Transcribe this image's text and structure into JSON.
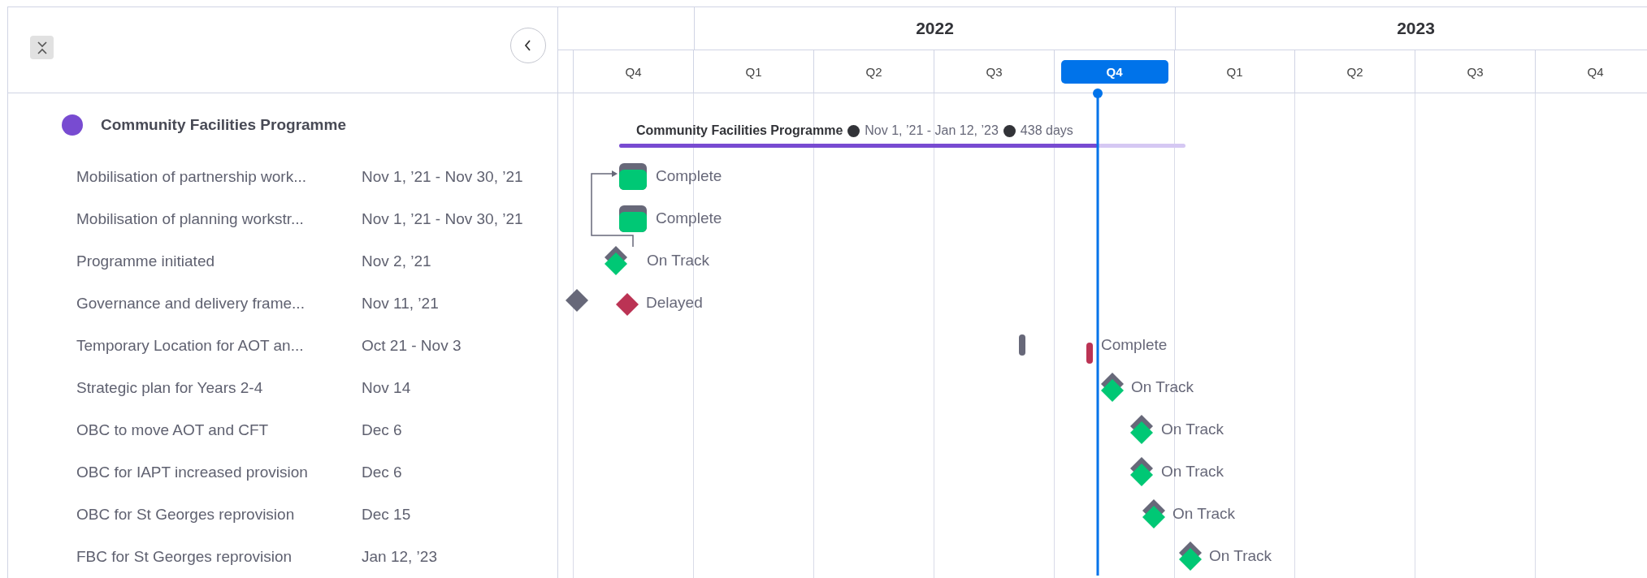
{
  "timeline": {
    "years": [
      {
        "label": "2022"
      },
      {
        "label": "2023"
      }
    ],
    "quarters": [
      {
        "label": "Q4",
        "selected": false
      },
      {
        "label": "Q1",
        "selected": false
      },
      {
        "label": "Q2",
        "selected": false
      },
      {
        "label": "Q3",
        "selected": false
      },
      {
        "label": "Q4",
        "selected": true
      },
      {
        "label": "Q1",
        "selected": false
      },
      {
        "label": "Q2",
        "selected": false
      },
      {
        "label": "Q3",
        "selected": false
      },
      {
        "label": "Q4",
        "selected": false
      }
    ]
  },
  "group": {
    "name": "Community Facilities Programme",
    "color": "#784bd1",
    "bar_title": "Community Facilities Programme",
    "date_range": "Nov 1, ’21 - Jan 12, ’23",
    "duration": "438 days",
    "level": 0.845
  },
  "items": [
    {
      "name": "Mobilisation of partnership work...",
      "dates": "Nov 1, ’21 - Nov 30, ’21",
      "kind": "bar",
      "status": "Complete",
      "color": "#00c875"
    },
    {
      "name": "Mobilisation of planning workstr...",
      "dates": "Nov 1, ’21 - Nov 30, ’21",
      "kind": "bar",
      "status": "Complete",
      "color": "#00c875"
    },
    {
      "name": "Programme initiated",
      "dates": "Nov 2, ’21",
      "kind": "milestone",
      "status": "On Track",
      "color": "#00c875"
    },
    {
      "name": "Governance and delivery frame...",
      "dates": "Nov 11, ’21",
      "kind": "milestone",
      "status": "Delayed",
      "color": "#bb3354"
    },
    {
      "name": "Temporary Location for AOT an...",
      "dates": "Oct 21 - Nov 3",
      "kind": "pill",
      "status": "Complete",
      "color": "#bb3354"
    },
    {
      "name": "Strategic plan for Years 2-4",
      "dates": "Nov 14",
      "kind": "milestone",
      "status": "On Track",
      "color": "#00c875"
    },
    {
      "name": "OBC to move AOT and CFT",
      "dates": "Dec 6",
      "kind": "milestone",
      "status": "On Track",
      "color": "#00c875"
    },
    {
      "name": "OBC for IAPT increased provision",
      "dates": "Dec 6",
      "kind": "milestone",
      "status": "On Track",
      "color": "#00c875"
    },
    {
      "name": "OBC for St Georges reprovision",
      "dates": "Dec 15",
      "kind": "milestone",
      "status": "On Track",
      "color": "#00c875"
    },
    {
      "name": "FBC for St Georges reprovision",
      "dates": "Jan 12, ’23",
      "kind": "milestone",
      "status": "On Track",
      "color": "#00c875"
    }
  ]
}
